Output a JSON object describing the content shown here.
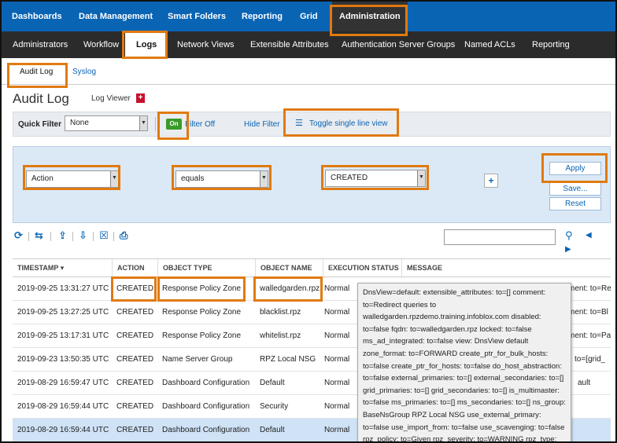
{
  "topnav": {
    "items": [
      "Dashboards",
      "Data Management",
      "Smart Folders",
      "Reporting",
      "Grid",
      "Administration"
    ]
  },
  "subnav": {
    "items": [
      "Administrators",
      "Workflow",
      "Logs",
      "Network Views",
      "Extensible Attributes",
      "Authentication Server Groups",
      "Named ACLs",
      "Reporting"
    ]
  },
  "tabs": [
    "Audit Log",
    "Syslog"
  ],
  "page": {
    "title": "Audit Log",
    "log_viewer": "Log Viewer"
  },
  "quick_filter": {
    "label": "Quick Filter",
    "value": "None",
    "toggle": "On",
    "filter_off": "Filter Off",
    "hide_filter": "Hide Filter",
    "toggle_single_line": "Toggle single line view"
  },
  "filter": {
    "field": "Action",
    "operator": "equals",
    "value": "CREATED",
    "apply": "Apply",
    "save": "Save...",
    "reset": "Reset"
  },
  "table": {
    "columns": [
      "TIMESTAMP",
      "ACTION",
      "OBJECT TYPE",
      "OBJECT NAME",
      "EXECUTION STATUS",
      "MESSAGE"
    ],
    "rows": [
      {
        "timestamp": "2019-09-25 13:31:27 UTC",
        "action": "CREATED",
        "object_type": "Response Policy Zone",
        "object_name": "walledgarden.rpz",
        "status": "Normal",
        "message": "ment: to=Re"
      },
      {
        "timestamp": "2019-09-25 13:27:25 UTC",
        "action": "CREATED",
        "object_type": "Response Policy Zone",
        "object_name": "blacklist.rpz",
        "status": "Normal",
        "message": "ment: to=Bl"
      },
      {
        "timestamp": "2019-09-25 13:17:31 UTC",
        "action": "CREATED",
        "object_type": "Response Policy Zone",
        "object_name": "whitelist.rpz",
        "status": "Normal",
        "message": "ment: to=Pa"
      },
      {
        "timestamp": "2019-09-23 13:50:35 UTC",
        "action": "CREATED",
        "object_type": "Name Server Group",
        "object_name": "RPZ Local NSG",
        "status": "Normal",
        "message": "to=[grid_"
      },
      {
        "timestamp": "2019-08-29 16:59:47 UTC",
        "action": "CREATED",
        "object_type": "Dashboard Configuration",
        "object_name": "Default",
        "status": "Normal",
        "message": "ault"
      },
      {
        "timestamp": "2019-08-29 16:59:44 UTC",
        "action": "CREATED",
        "object_type": "Dashboard Configuration",
        "object_name": "Security",
        "status": "Normal",
        "message": ""
      },
      {
        "timestamp": "2019-08-29 16:59:44 UTC",
        "action": "CREATED",
        "object_type": "Dashboard Configuration",
        "object_name": "Default",
        "status": "Normal",
        "message": ""
      }
    ]
  },
  "tooltip": {
    "text": "DnsView=default: extensible_attributes: to=[] comment: to=Redirect queries to walledgarden.rpzdemo.training.infoblox.com disabled: to=false fqdn: to=walledgarden.rpz locked: to=false ms_ad_integrated: to=false view: DnsView default zone_format: to=FORWARD create_ptr_for_bulk_hosts: to=false create_ptr_for_hosts: to=false do_host_abstraction: to=false external_primaries: to=[] external_secondaries: to=[] grid_primaries: to=[] grid_secondaries: to=[] is_multimaster: to=false ms_primaries: to=[] ms_secondaries: to=[] ns_group: BaseNsGroup RPZ Local NSG use_external_primary: to=false use_import_from: to=false use_scavenging: to=false rpz_policy: to=Given rpz_severity: to=WARNING rpz_type: to=LOCAL"
  },
  "colors": {
    "brand_blue": "#0a64b4",
    "dark_nav": "#2b2b2b",
    "highlight_orange": "#e07a10",
    "toggle_green": "#3a9a2a",
    "row_selected": "#cfe2f6"
  }
}
